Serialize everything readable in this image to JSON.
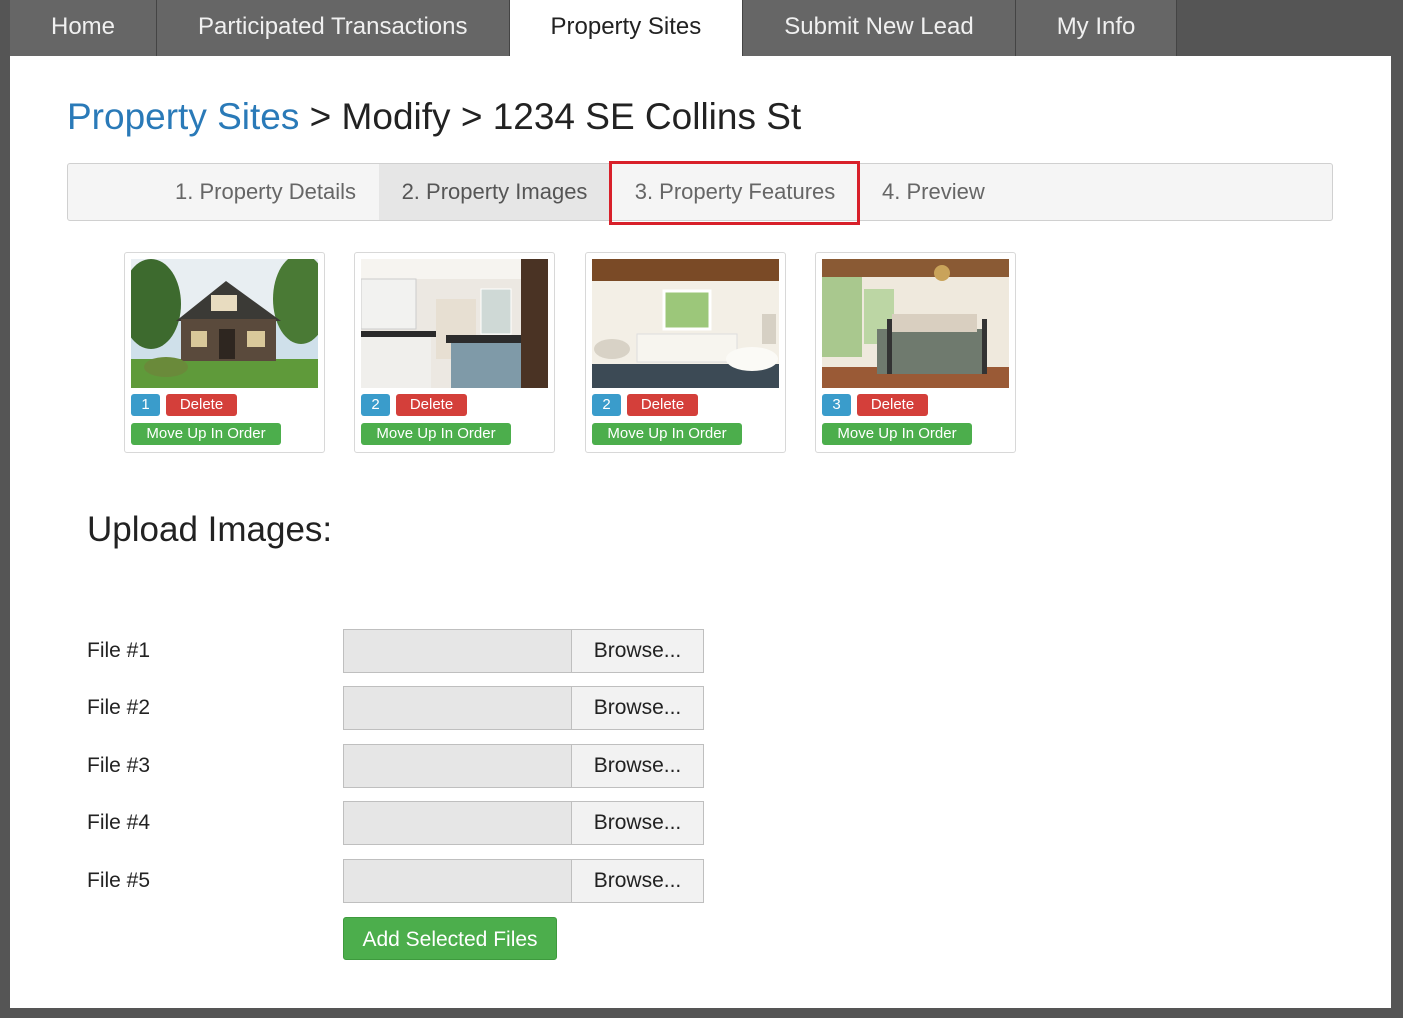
{
  "nav": {
    "tabs": [
      {
        "label": "Home"
      },
      {
        "label": "Participated Transactions"
      },
      {
        "label": "Property Sites"
      },
      {
        "label": "Submit New Lead"
      },
      {
        "label": "My Info"
      }
    ],
    "active_index": 2
  },
  "breadcrumb": {
    "root": "Property Sites",
    "sep1": ">",
    "action": "Modify",
    "sep2": ">",
    "address": "1234 SE Collins St"
  },
  "steps": [
    {
      "label": "1. Property Details"
    },
    {
      "label": "2. Property Images"
    },
    {
      "label": "3. Property Features"
    },
    {
      "label": "4. Preview"
    }
  ],
  "images": [
    {
      "order": "1",
      "delete_label": "Delete",
      "move_label": "Move Up In Order",
      "subject": "house exterior"
    },
    {
      "order": "2",
      "delete_label": "Delete",
      "move_label": "Move Up In Order",
      "subject": "kitchen"
    },
    {
      "order": "2",
      "delete_label": "Delete",
      "move_label": "Move Up In Order",
      "subject": "bathroom"
    },
    {
      "order": "3",
      "delete_label": "Delete",
      "move_label": "Move Up In Order",
      "subject": "bedroom"
    }
  ],
  "upload": {
    "title": "Upload Images:",
    "files": [
      {
        "label": "File #1",
        "browse_label": "Browse..."
      },
      {
        "label": "File #2",
        "browse_label": "Browse..."
      },
      {
        "label": "File #3",
        "browse_label": "Browse..."
      },
      {
        "label": "File #4",
        "browse_label": "Browse..."
      },
      {
        "label": "File #5",
        "browse_label": "Browse..."
      }
    ],
    "submit_label": "Add Selected Files"
  },
  "colors": {
    "link": "#2a7ab8",
    "highlight": "#d8202a",
    "danger": "#d43f3a",
    "success": "#4cae4c",
    "info": "#3a9ccb",
    "nav_bg": "#666666"
  }
}
